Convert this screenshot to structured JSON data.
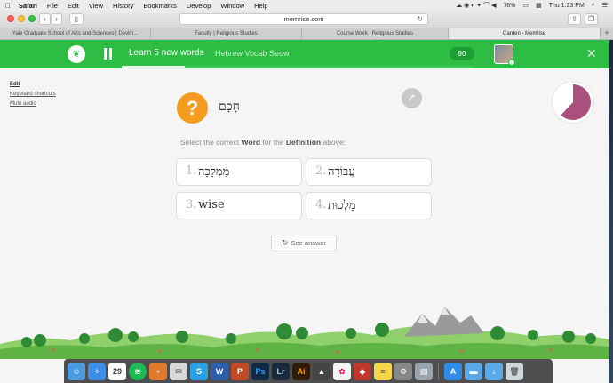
{
  "menubar": {
    "apple": "",
    "items": [
      "Safari",
      "File",
      "Edit",
      "View",
      "History",
      "Bookmarks",
      "Develop",
      "Window",
      "Help"
    ],
    "battery": "76%",
    "clock": "Thu 1:23 PM"
  },
  "browser": {
    "url": "memrise.com",
    "tabs": [
      "Yale Graduate School of Arts and Sciences | Devlin...",
      "Faculty | Religious Studies",
      "Course Work | Religious Studies",
      "Garden - Memrise"
    ]
  },
  "session": {
    "title": "Learn 5 new words",
    "course": "Hebrew Vocab Seow",
    "points": "90",
    "progress": 0.18
  },
  "sidebar": {
    "edit": "Edit",
    "keyboard": "Keyboard shortcuts",
    "mute": "Mute audio"
  },
  "question": {
    "icon": "?",
    "word": "חָכָם",
    "instruction_pre": "Select the correct ",
    "instruction_word": "Word",
    "instruction_mid": " for the ",
    "instruction_def": "Definition",
    "instruction_post": " above:",
    "timer_fraction": 0.62
  },
  "choices": [
    {
      "num": "1.",
      "text": "מַמְלָכָה"
    },
    {
      "num": "2.",
      "text": "עֲבוֹדָה"
    },
    {
      "num": "3.",
      "text": "wise"
    },
    {
      "num": "4.",
      "text": "מַלְכוּת"
    }
  ],
  "see_answer": "See answer",
  "dock": {
    "calendar_day": "29",
    "apps": [
      "finder-icon",
      "safari-icon",
      "calendar-icon",
      "spotify-icon",
      "app-icon",
      "app-icon",
      "skype-icon",
      "word-icon",
      "powerpoint-icon",
      "photoshop-icon",
      "lightroom-icon",
      "illustrator-icon",
      "app-icon",
      "photos-icon",
      "app-icon",
      "notes-icon",
      "app-icon",
      "app-icon",
      "appstore-icon",
      "folder-icon",
      "downloads-icon",
      "trash-icon"
    ]
  }
}
